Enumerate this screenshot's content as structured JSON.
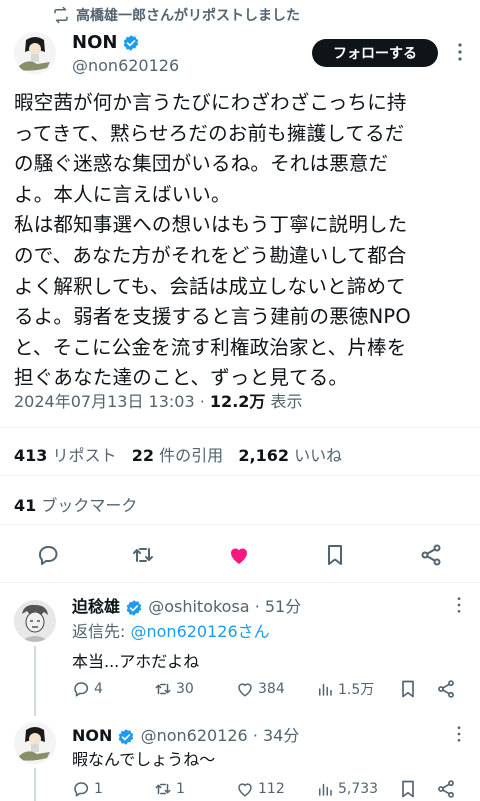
{
  "repost_header": {
    "text": "高橋雄一郎さんがリポストしました",
    "icon": "repost-icon"
  },
  "tweet": {
    "author": {
      "name": "NON",
      "handle": "@non620126",
      "verified": true
    },
    "follow_label": "フォローする",
    "body": "暇空茜が何か言うたびにわざわざこっちに持\nってきて、黙らせろだのお前も擁護してるだ\nの騒ぐ迷惑な集団がいるね。それは悪意だ\nよ。本人に言えばいい。\n私は都知事選への想いはもう丁寧に説明した\nので、あなた方がそれをどう勘違いして都合\nよく解釈しても、会話は成立しないと諦めて\nるよ。弱者を支援すると言う建前の悪徳NPO\nと、そこに公金を流す利権政治家と、片棒を\n担ぐあなた達のこと、ずっと見てる。",
    "timestamp": "2024年07月13日 13:03",
    "separator": "·",
    "views": "12.2万",
    "views_label": "表示",
    "reposts": "413",
    "reposts_label": "リポスト",
    "quotes": "22",
    "quotes_label": "件の引用",
    "likes": "2,162",
    "likes_label": "いいね",
    "bookmarks": "41",
    "bookmarks_label": "ブックマーク"
  },
  "actions": [
    "reply-icon",
    "repost-icon",
    "like-icon",
    "bookmark-icon",
    "share-icon"
  ],
  "colors": {
    "like_active": "#f91880",
    "muted": "#536471",
    "link": "#1d9bf0",
    "verified": "#1d9bf0"
  },
  "replies": [
    {
      "name": "迫稔雄",
      "handle": "@oshitokosa",
      "time": "· 51分",
      "replying_to_label": "返信先:",
      "replying_to": "@non620126さん",
      "text": "本当...アホだよね",
      "stats": {
        "replies": "4",
        "reposts": "30",
        "likes": "384",
        "views": "1.5万"
      }
    },
    {
      "name": "NON",
      "handle": "@non620126",
      "time": "· 34分",
      "text": "暇なんでしょうね〜",
      "stats": {
        "replies": "1",
        "reposts": "1",
        "likes": "112",
        "views": "5,733"
      }
    }
  ]
}
